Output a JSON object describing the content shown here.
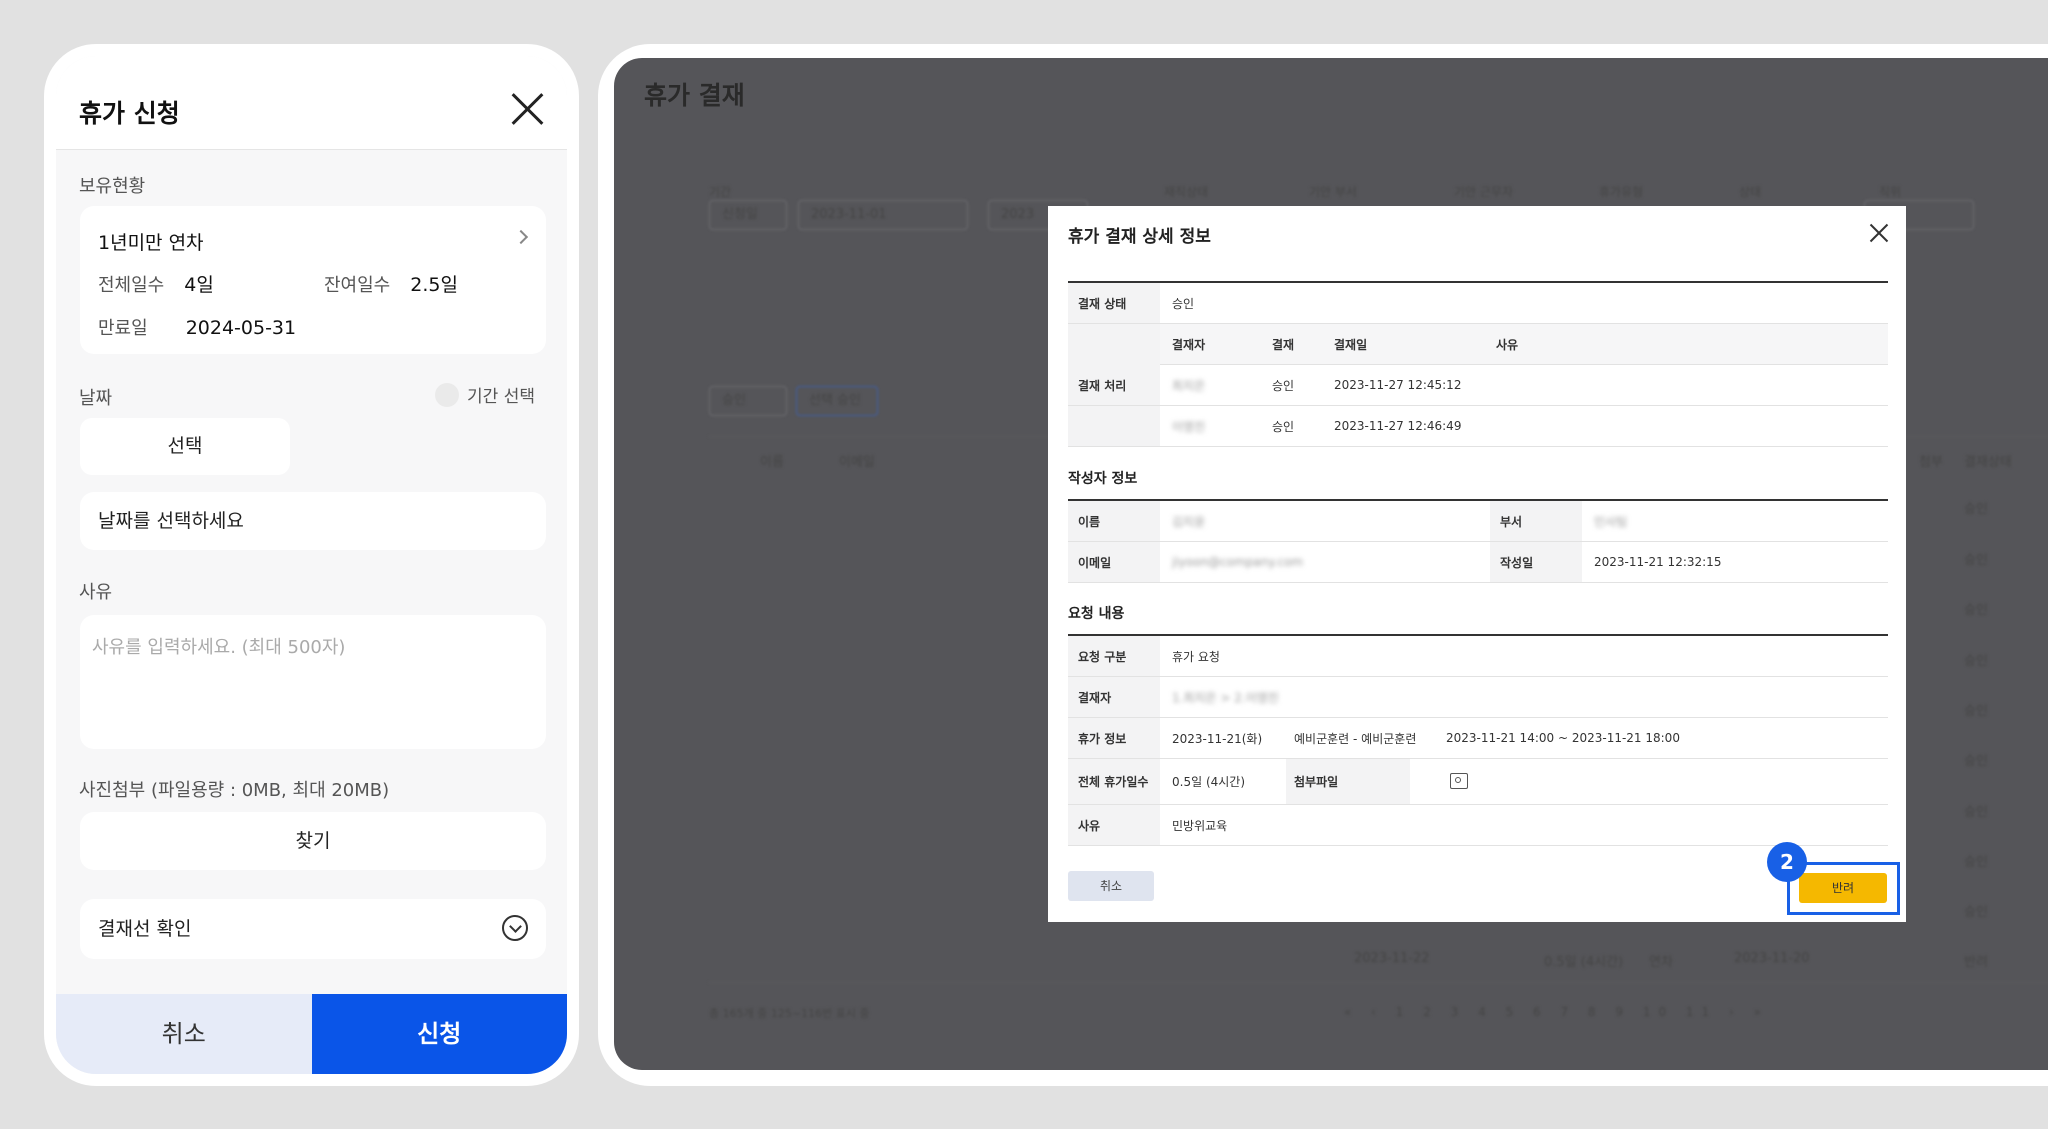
{
  "mobile": {
    "title": "휴가 신청",
    "holdings_label": "보유현황",
    "leave_type": "1년미만 연차",
    "total_days_label": "전체일수",
    "total_days": "4일",
    "remaining_label": "잔여일수",
    "remaining_days": "2.5일",
    "expiry_label": "만료일",
    "expiry_date": "2024-05-31",
    "date_label": "날짜",
    "period_select_label": "기간 선택",
    "select_button": "선택",
    "date_placeholder": "날짜를 선택하세요",
    "reason_label": "사유",
    "reason_placeholder": "사유를 입력하세요. (최대 500자)",
    "attach_label": "사진첨부 (파일용량 : 0MB, 최대 20MB)",
    "find_button": "찾기",
    "approval_line": "결재선 확인",
    "cancel_button": "취소",
    "apply_button": "신청"
  },
  "desktop": {
    "title": "휴가 결재",
    "filters": {
      "period_label": "기간",
      "period_type": "신청일",
      "start_date": "2023-11-01",
      "end_date_partial": "2023",
      "status_label": "재직상태",
      "dept_label": "기안 부서",
      "drafter_label": "기안 근무자",
      "leave_type_label": "휴가유형",
      "state_label": "상태",
      "position_label": "직위"
    },
    "bulk": {
      "status_select": "승인",
      "bulk_approve": "선택 승인"
    },
    "columns": {
      "name": "이름",
      "email": "이메일",
      "attach": "첨부",
      "approval_status": "결재상태"
    },
    "row_statuses": [
      "승인",
      "승인",
      "승인",
      "승인",
      "승인",
      "승인",
      "승인",
      "승인",
      "승인",
      "반려"
    ],
    "last_row": {
      "date": "2023-11-22",
      "amount": "0.5일 (4시간)",
      "type": "연차",
      "applied": "2023-11-20"
    },
    "summary": "총 165개 중 125~116번 표시 중",
    "pager": "« ‹ 1 2 3 4 5 6 7 8 9 10 11 › »"
  },
  "modal": {
    "title": "휴가 결재 상세 정보",
    "approval_status_label": "결재 상태",
    "approval_status": "승인",
    "approval_process_label": "결재 처리",
    "process_headers": {
      "approver": "결재자",
      "result": "결재",
      "date": "결재일",
      "reason": "사유"
    },
    "process_rows": [
      {
        "approver": "최지은",
        "result": "승인",
        "date": "2023-11-27 12:45:12"
      },
      {
        "approver": "이영진",
        "result": "승인",
        "date": "2023-11-27 12:46:49"
      }
    ],
    "writer_section": "작성자 정보",
    "name_label": "이름",
    "name_value": "김지윤",
    "dept_label": "부서",
    "dept_value": "인사팀",
    "email_label": "이메일",
    "email_value": "jiyoon@company.com",
    "created_label": "작성일",
    "created_value": "2023-11-21 12:32:15",
    "request_section": "요청 내용",
    "req_type_label": "요청 구분",
    "req_type_value": "휴가 요청",
    "approver_label": "결재자",
    "approver_value": "1.최지은 > 2.이영진",
    "leave_info_label": "휴가 정보",
    "leave_info_date": "2023-11-21(화)",
    "leave_info_kind": "예비군훈련 - 예비군훈련",
    "leave_info_range": "2023-11-21 14:00 ~ 2023-11-21 18:00",
    "total_leave_label": "전체 휴가일수",
    "total_leave_value": "0.5일 (4시간)",
    "attach_label": "첨부파일",
    "reason_label": "사유",
    "reason_value": "민방위교육",
    "cancel_button": "취소",
    "reject_button": "반려",
    "step_badge": "2"
  }
}
